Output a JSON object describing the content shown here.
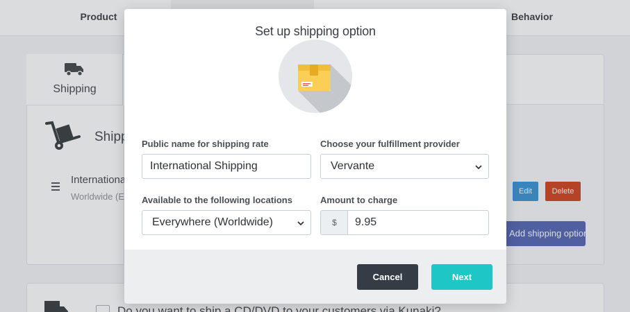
{
  "nav": {
    "tabs": [
      {
        "label": "Product"
      },
      {
        "label": ""
      },
      {
        "label": ""
      },
      {
        "label": "Behavior"
      }
    ]
  },
  "sidebar_tab": {
    "label": "Shipping",
    "icon": "truck-icon"
  },
  "section": {
    "title": "Shipping",
    "rate": {
      "name": "International Shipping",
      "sub": "Worldwide (Everywhere)"
    },
    "edit_label": "Edit",
    "delete_label": "Delete",
    "add_label": "Add shipping option"
  },
  "cd_question": "Do you want to ship a CD/DVD to your customers via Kunaki?",
  "modal": {
    "title": "Set up shipping option",
    "fields": {
      "public_name": {
        "label": "Public name for shipping rate",
        "value": "International Shipping"
      },
      "provider": {
        "label": "Choose your fulfillment provider",
        "value": "Vervante"
      },
      "locations": {
        "label": "Available to the following locations",
        "value": "Everywhere (Worldwide)"
      },
      "amount": {
        "label": "Amount to charge",
        "currency": "$",
        "value": "9.95"
      }
    },
    "cancel_label": "Cancel",
    "next_label": "Next"
  },
  "colors": {
    "edit": "#2f8fd4",
    "delete": "#cf3b17",
    "add_button": "#4c5fb0",
    "cancel": "#353c45",
    "next": "#1fc6c6",
    "box_yellow": "#fbcf56"
  }
}
